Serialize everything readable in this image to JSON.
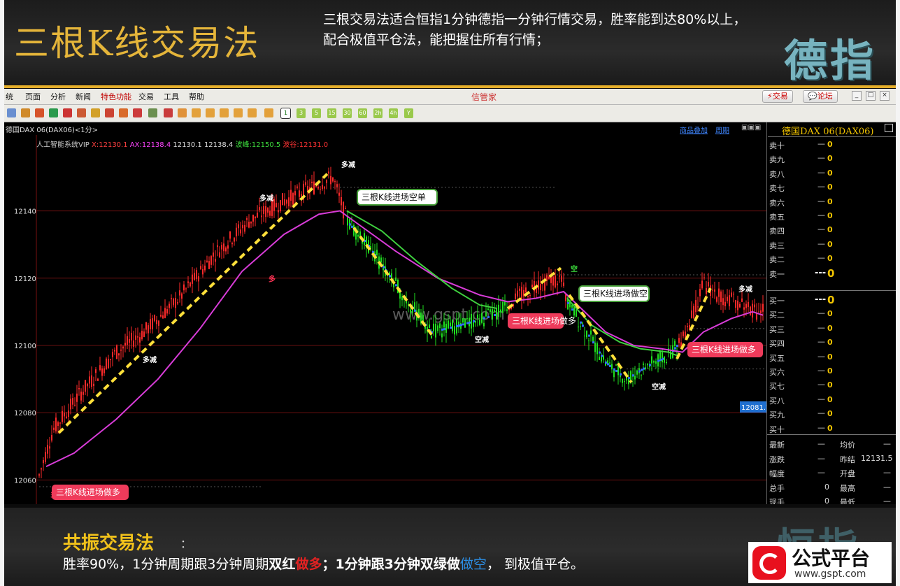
{
  "banner": {
    "title": "三根K线交易法",
    "desc_line1": "三根交易法适合恒指1分钟德指一分钟行情交易，胜率能到达80%以上，",
    "desc_line2": "配合极值平仓法，能把握住所有行情；",
    "watermark": "德指"
  },
  "app": {
    "menu": [
      "统",
      "页面",
      "分析",
      "新闻",
      "特色功能",
      "交易",
      "工具",
      "帮助"
    ],
    "title": "信管家",
    "trade_btn": "交易",
    "forum_btn": "论坛",
    "periods": [
      "1",
      "3",
      "5",
      "15",
      "30",
      "60",
      "2h",
      "4h",
      "Y"
    ],
    "selected_period": "1"
  },
  "chart_header": {
    "symbol": "德国DAX 06(DAX06)<1分>",
    "indicator_name": "人工智能系统VIP",
    "x": "X:12130.1",
    "ax": "AX:12138.4",
    "v1": "12130.1",
    "v2": "12138.4",
    "bolan": "波峰:12150.5",
    "bogu": "波谷:12131.0",
    "link1": "商品叠加",
    "link2": "周期"
  },
  "chart_data": {
    "type": "line",
    "ylim": [
      12053,
      12158
    ],
    "y_ticks": [
      12060,
      12080,
      12100,
      12120,
      12140
    ],
    "price_tag": "12081.7",
    "series": [],
    "signals": [
      "多",
      "多",
      "多减",
      "多减",
      "多减",
      "空减",
      "空减",
      "空",
      "多减"
    ],
    "callouts": [
      "三根K线进场做多",
      "三根K线进场空单",
      "三根K线进场做多",
      "三根K线进场做空",
      "三根K线进场做多"
    ],
    "watermark": "www.gspt.com"
  },
  "side": {
    "title": "德国DAX 06(DAX06)",
    "sells": [
      "卖十",
      "卖九",
      "卖八",
      "卖七",
      "卖六",
      "卖五",
      "卖四",
      "卖三",
      "卖二",
      "卖一"
    ],
    "buys": [
      "买一",
      "买二",
      "买三",
      "买四",
      "买五",
      "买六",
      "买七",
      "买八",
      "买九",
      "买十"
    ],
    "dash": "—",
    "zero": "0",
    "top_dash": "---",
    "stats": [
      {
        "l": "最新",
        "lv": "—",
        "r": "均价",
        "rv": "—"
      },
      {
        "l": "涨跌",
        "lv": "—",
        "r": "昨结",
        "rv": "12131.5"
      },
      {
        "l": "幅度",
        "lv": "—",
        "r": "开盘",
        "rv": "—"
      },
      {
        "l": "总手",
        "lv": "0",
        "r": "最高",
        "rv": "—"
      },
      {
        "l": "现手",
        "lv": "0",
        "r": "最低",
        "rv": "—"
      }
    ]
  },
  "footer": {
    "title": "共振交易法",
    "colon": "：",
    "t1": "胜率90%，1分钟周期跟3分钟周期",
    "t2": "双红",
    "t3": "做多",
    "t4": "；1分钟跟3分钟双绿",
    "t5": "做",
    "t6": "做空",
    "t7": "， 到极值平仓。",
    "watermark": "恒指"
  },
  "logo": {
    "name": "公式平台",
    "url": "www.gspt.com"
  }
}
